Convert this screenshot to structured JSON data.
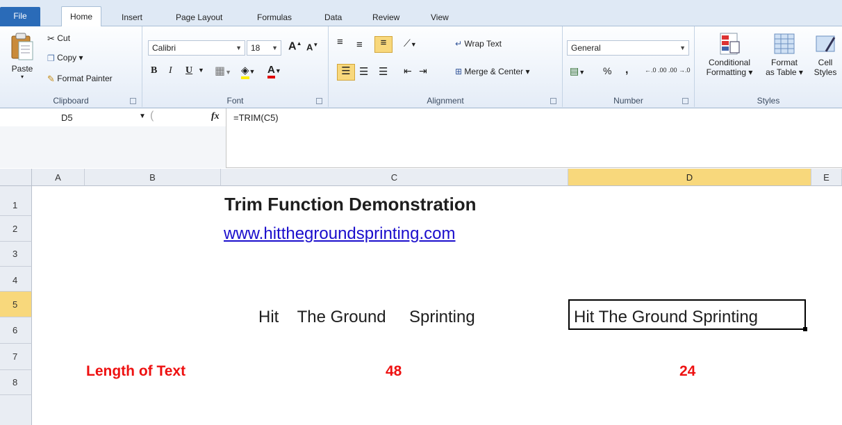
{
  "tabs": {
    "file": "File",
    "items": [
      "Home",
      "Insert",
      "Page Layout",
      "Formulas",
      "Data",
      "Review",
      "View"
    ],
    "active": "Home"
  },
  "clipboard": {
    "paste": "Paste",
    "cut": "Cut",
    "copy": "Copy",
    "copy_arrow": "▾",
    "format_painter": "Format Painter",
    "label": "Clipboard"
  },
  "font": {
    "name": "Calibri",
    "size": "18",
    "label": "Font",
    "bold": "B",
    "italic": "I",
    "underline": "U",
    "grow": "A",
    "shrink": "A"
  },
  "alignment": {
    "wrap": "Wrap Text",
    "merge": "Merge & Center",
    "merge_arrow": "▾",
    "label": "Alignment"
  },
  "number": {
    "format": "General",
    "percent": "%",
    "comma": ",",
    "label": "Number",
    "inc_decimal": "←.0 .00",
    "dec_decimal": ".00 →.0"
  },
  "styles": {
    "conditional_line1": "Conditional",
    "conditional_line2": "Formatting ▾",
    "format_table_line1": "Format",
    "format_table_line2": "as Table ▾",
    "cell_line1": "Cell",
    "cell_line2": "Styles",
    "label": "Styles"
  },
  "formula_bar": {
    "name_box": "D5",
    "fx": "fx",
    "formula": "=TRIM(C5)"
  },
  "columns": [
    "A",
    "B",
    "C",
    "D",
    "E"
  ],
  "rows": [
    "1",
    "2",
    "3",
    "4",
    "5",
    "6",
    "7",
    "8"
  ],
  "cells": {
    "C1": "Trim Function Demonstration",
    "C2": "www.hitthegroundsprinting.com",
    "C5": "Hit    The Ground     Sprinting",
    "D5": "Hit The Ground Sprinting",
    "B7": "Length of Text",
    "C7": "48",
    "D7": "24"
  },
  "colors": {
    "accent": "#2a6bb8",
    "selected_header": "#f8d87c",
    "red_text": "#ee1111",
    "link": "#1a0dcc"
  }
}
